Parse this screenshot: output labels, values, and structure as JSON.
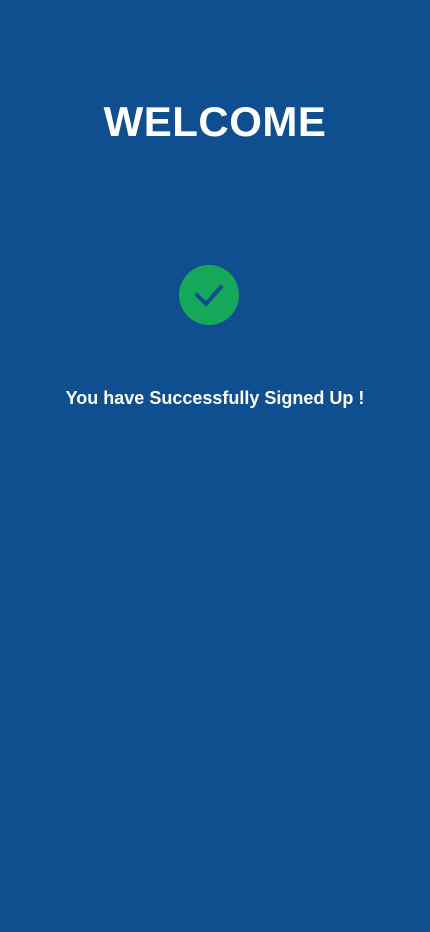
{
  "welcome": {
    "title": "WELCOME",
    "message": "You have Successfully Signed Up !"
  },
  "icons": {
    "success": "check-circle-icon"
  },
  "colors": {
    "background": "#0f4e8f",
    "success_badge": "#16a85a",
    "checkmark": "#0f4e8f",
    "text": "#ffffff"
  }
}
